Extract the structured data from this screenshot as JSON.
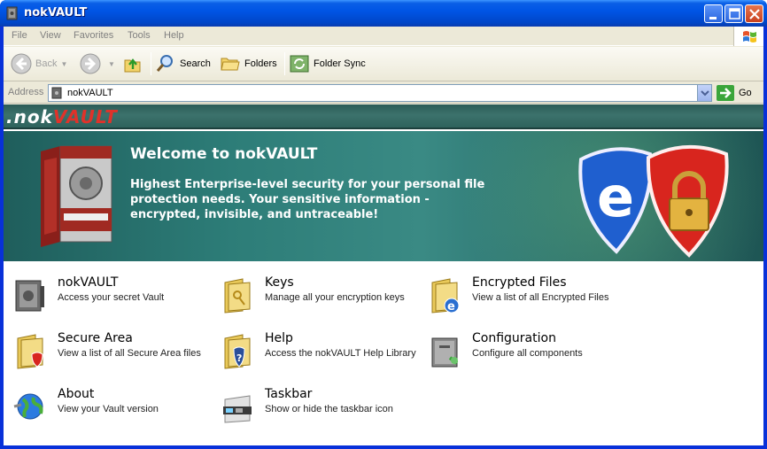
{
  "window": {
    "title": "nokVAULT"
  },
  "menu": [
    "File",
    "View",
    "Favorites",
    "Tools",
    "Help"
  ],
  "toolbar": {
    "back_label": "Back",
    "search_label": "Search",
    "folders_label": "Folders",
    "folder_sync_label": "Folder Sync"
  },
  "address": {
    "label": "Address",
    "value": "nokVAULT",
    "go_label": "Go"
  },
  "brand": {
    "logo_part1": ".nok",
    "logo_part2": "VAULT"
  },
  "banner": {
    "heading": "Welcome to nokVAULT",
    "description": "Highest Enterprise-level security for your personal file protection needs. Your sensitive information - encrypted, invisible, and untraceable!"
  },
  "items": [
    {
      "title": "nokVAULT",
      "subtitle": "Access your secret Vault",
      "icon": "vault-icon"
    },
    {
      "title": "Keys",
      "subtitle": "Manage all your encryption keys",
      "icon": "keys-folder-icon"
    },
    {
      "title": "Encrypted Files",
      "subtitle": "View a list of all Encrypted Files",
      "icon": "encrypted-files-folder-icon"
    },
    {
      "title": "Secure Area",
      "subtitle": "View a list of all Secure Area files",
      "icon": "secure-area-folder-icon"
    },
    {
      "title": "Help",
      "subtitle": "Access the nokVAULT Help Library",
      "icon": "help-folder-icon"
    },
    {
      "title": "Configuration",
      "subtitle": "Configure all components",
      "icon": "configuration-icon"
    },
    {
      "title": "About",
      "subtitle": "View your Vault version",
      "icon": "globe-icon"
    },
    {
      "title": "Taskbar",
      "subtitle": "Show or hide the taskbar icon",
      "icon": "taskbar-icon"
    }
  ]
}
